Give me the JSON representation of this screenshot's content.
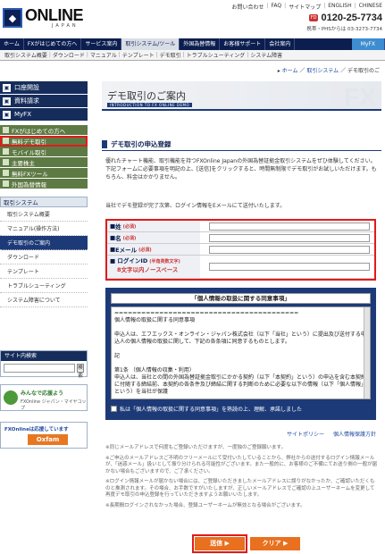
{
  "header": {
    "logo_mark": "◆",
    "logo_text": "ONLINE",
    "logo_sub": "JAPAN",
    "toplinks": [
      "お問い合わせ",
      "FAQ",
      "サイトマップ",
      "ENGLISH",
      "CHINESE"
    ],
    "free_dial": "FD",
    "phone": "0120-25-7734",
    "phone_note": "携帯・PHSからは 03-3273-7734"
  },
  "gnav": [
    "ホーム",
    "FXがはじめての方へ",
    "サービス案内",
    "取引システム/ツール",
    "外国為替情報",
    "お客様サポート",
    "会社案内",
    "MyFX"
  ],
  "snav": [
    "取引システム概要",
    "ダウンロード",
    "マニュアル",
    "テンプレート",
    "デモ取引",
    "トラブルシューティング",
    "システム障害"
  ],
  "crumb": {
    "home": "ホーム",
    "sys": "取引システム",
    "cur": "デモ取引のご"
  },
  "side": {
    "top": [
      {
        "label": "口座開設",
        "ic": "▣"
      },
      {
        "label": "資料請求",
        "ic": "▣"
      },
      {
        "label": "MyFX",
        "ic": "▣"
      }
    ],
    "green": [
      "FXがはじめての方へ",
      "無料デモ取引",
      "モバイル取引",
      "主要株主",
      "無料FXツール",
      "外国為替情報"
    ],
    "sec": "取引システム",
    "subs": [
      "取引システム概要",
      "マニュアル(操作方法)",
      "デモ取引のご案内",
      "ダウンロード",
      "テンプレート",
      "トラブルシューティング",
      "システム障害について"
    ],
    "search_title": "サイト内検索",
    "search_btn": "検索",
    "ban1_t": "みんなで応援よう ",
    "ban1_s": "FXOnline ジャパン・マイヤコップ",
    "ban2_t": "FXOnlineは応援しています",
    "ban2_d": "Oxfam"
  },
  "main": {
    "title": "デモ取引のご案内",
    "subtitle": "INTRODUCTION TO FX ONLINE DEMO",
    "bgfx": "FX",
    "sec_title": "デモ取引の申込登録",
    "intro": "優れたチャート機能、取引機能を持つFXOnline Japanの外国為替証拠金取引システムをぜひ体験してください。下記フォームに必要事項を明記の上、[送信]をクリックすると、時間無制限でデモ取引がお試しいただけます。もちろん、料金はかかりません。",
    "note1": "当社でデモ登録が完了次第、ログイン情報をEメールにて送付いたします。",
    "form": [
      {
        "label": "姓",
        "req": "(必須)"
      },
      {
        "label": "名",
        "req": "(必須)"
      },
      {
        "label": "Eメール",
        "req": "(必須)"
      },
      {
        "label": "ログインID",
        "req": "(半角英数文字)",
        "label2": "8文字以内ノースペース"
      }
    ],
    "agree_title": "「個人情報の取扱に関する同意事項」",
    "agree_body": [
      "=========================================",
      "個人情報の取扱に関する同意事項",
      "",
      "申込人は、エフエックス・オンライン・ジャパン株式会社（以下「当社」という）に提出及び送付する申込人の個人情報の取扱に関して、下記の各条項に同意するものとします。",
      "",
      "記",
      "",
      "第1条 （個人情報の収集・利用）",
      "申込人は、当社との間の外国為替証拠金取引にかかる契約（以下「本契約」という）の申込を含む本契約に付随する締結前、本契約の各条件及び締結に関する判断のために必要な以下の情報（以下「個人情報」という）を当社が保護"
    ],
    "agree_check": "私は「個人情報の取扱に関する同意事項」を熟読の上、理解、承諾しました",
    "plink1": "サイトポリシー",
    "plink2": "個人情報保護方針",
    "notes": [
      "※同じメールアドレスで何度もご登録いただけますが、一度独のご登録願います。",
      "※ご申込のメールアドレスご不明のフリーメールにて受付いたしていることから、弊社からの送付するログイン情報メールが、「迷惑メール」扱いとして振り分けられる可能性がございます。また一般的に、お客様のご不備にてお送り側の一般が届かない場合もございますので、ご了承ください。",
      "※ログイン情報メールが届かない場合には、ご登録いただきましたメールアドレスに誤りがなかったか、ご確認いただくものと推測されます。その場合、お手数ですがいたしますが、正しいメールアドレスでご確認の上ユーザーネームを変更して再度デモ取引の申込登録を行っていただきますようお願いいたします。",
      "※長期間ログインされなかった場合、登録ユーザーネームが無効となる場合がございます。"
    ],
    "btn_send": "送信 ▶",
    "btn_clear": "クリア ▶"
  }
}
